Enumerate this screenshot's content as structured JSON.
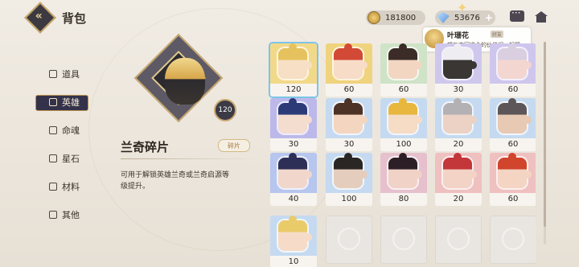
{
  "header": {
    "back_icon": "back-logo-icon",
    "title": "背包",
    "gold": "181800",
    "gems": "53676",
    "plus": "+"
  },
  "notification": {
    "name": "叶珊花",
    "badge": "好友",
    "message": "想与志同道合的伙伴们一起冒..."
  },
  "nav": {
    "items": [
      {
        "label": "道具",
        "icon": "item-icon"
      },
      {
        "label": "英雄",
        "icon": "hero-icon"
      },
      {
        "label": "命魂",
        "icon": "soul-icon"
      },
      {
        "label": "星石",
        "icon": "star-stone-icon"
      },
      {
        "label": "材料",
        "icon": "material-icon"
      },
      {
        "label": "其他",
        "icon": "other-icon"
      }
    ],
    "active": "英雄"
  },
  "detail": {
    "count": "120",
    "name": "兰奇碎片",
    "tag": "碎片",
    "description": "可用于解锁英雄兰奇或兰奇启源等级提升。"
  },
  "grid": {
    "cards": [
      {
        "count": "120",
        "bg": "#f2d98a",
        "hair": "#e6c25e",
        "skin": "#f6dfc4",
        "selected": true
      },
      {
        "count": "60",
        "bg": "#f0d37e",
        "hair": "#d24a35",
        "skin": "#f7dcc8"
      },
      {
        "count": "60",
        "bg": "#cfe3c6",
        "hair": "#3b2c28",
        "skin": "#f3d6c2"
      },
      {
        "count": "30",
        "bg": "#cfc8ec",
        "hair": "#eeeef2",
        "skin": "#3a3634"
      },
      {
        "count": "60",
        "bg": "#cfc6ee",
        "hair": "#d9cfe0",
        "skin": "#f3d6d0"
      },
      {
        "count": "30",
        "bg": "#bdb8ea",
        "hair": "#2c3b78",
        "skin": "#f4dccf"
      },
      {
        "count": "30",
        "bg": "#c5daf0",
        "hair": "#4d3226",
        "skin": "#f4d6c0"
      },
      {
        "count": "100",
        "bg": "#c5daf0",
        "hair": "#e8b73e",
        "skin": "#f6dbc5"
      },
      {
        "count": "20",
        "bg": "#c5daf0",
        "hair": "#b3b1b4",
        "skin": "#ecd2c4"
      },
      {
        "count": "60",
        "bg": "#c5daf0",
        "hair": "#5d5658",
        "skin": "#e7c9b4"
      },
      {
        "count": "40",
        "bg": "#b7c6ee",
        "hair": "#2e2f56",
        "skin": "#f1d7cb"
      },
      {
        "count": "100",
        "bg": "#c5daf0",
        "hair": "#2a2624",
        "skin": "#e5cdbd"
      },
      {
        "count": "80",
        "bg": "#e6c0cd",
        "hair": "#2d1f26",
        "skin": "#f0d2c6"
      },
      {
        "count": "20",
        "bg": "#efc0c0",
        "hair": "#c3363a",
        "skin": "#f2d3c6"
      },
      {
        "count": "60",
        "bg": "#efc0c0",
        "hair": "#d0452c",
        "skin": "#f4d5c3"
      },
      {
        "count": "10",
        "bg": "#c5daf0",
        "hair": "#eacb6a",
        "skin": "#f6dcc8"
      }
    ],
    "empty_slots": 4
  }
}
